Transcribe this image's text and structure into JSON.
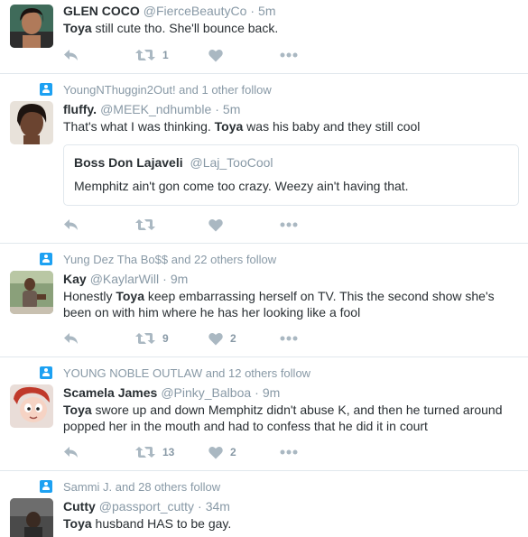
{
  "tweets": [
    {
      "context": "",
      "name": "GLEN COCO",
      "handle": "@FierceBeautyCo",
      "dot": "·",
      "time": "5m",
      "text_pre": "",
      "text_bold": "Toya",
      "text_post": " still cute tho. She'll bounce back.",
      "retweets": "1",
      "likes": ""
    },
    {
      "context": "YoungNThuggin2Out! and 1 other follow",
      "name": "fluffy.",
      "handle": "@MEEK_ndhumble",
      "dot": "·",
      "time": "5m",
      "text_pre": "That's what I was thinking. ",
      "text_bold": "Toya",
      "text_post": " was his baby and they still cool",
      "quote": {
        "name": "Boss Don Lajaveli",
        "handle": "@Laj_TooCool",
        "text": "Memphitz ain't gon come too crazy. Weezy ain't having that."
      },
      "retweets": "",
      "likes": ""
    },
    {
      "context": "Yung Dez Tha Bo$$ and 22 others follow",
      "name": "Kay",
      "handle": "@KaylarWill",
      "dot": "·",
      "time": "9m",
      "text_pre": "Honestly ",
      "text_bold": "Toya",
      "text_post": " keep embarrassing herself on TV. This the second show she's been on with him where he has her looking like a fool",
      "retweets": "9",
      "likes": "2"
    },
    {
      "context": "YOUNG NOBLE OUTLAW and 12 others follow",
      "name": "Scamela James",
      "handle": "@Pinky_Balboa",
      "dot": "·",
      "time": "9m",
      "text_pre": "",
      "text_bold": "Toya",
      "text_post": " swore up and down Memphitz didn't abuse K, and then he turned around popped her in the mouth and had to confess that he did it in court",
      "retweets": "13",
      "likes": "2"
    },
    {
      "context": "Sammi J. and 28 others follow",
      "name": "Cutty",
      "handle": "@passport_cutty",
      "dot": "·",
      "time": "34m",
      "text_pre": "",
      "text_bold": "Toya",
      "text_post": " husband HAS to be gay."
    }
  ],
  "icons": {
    "reply": "reply-icon",
    "retweet": "retweet-icon",
    "like": "heart-icon",
    "more": "more-icon",
    "follow": "follow-context-icon"
  },
  "colors": {
    "icon": "#aab8c2",
    "muted": "#8899a6",
    "text": "#292f33",
    "accent": "#1da1f2",
    "border": "#e1e8ed"
  }
}
